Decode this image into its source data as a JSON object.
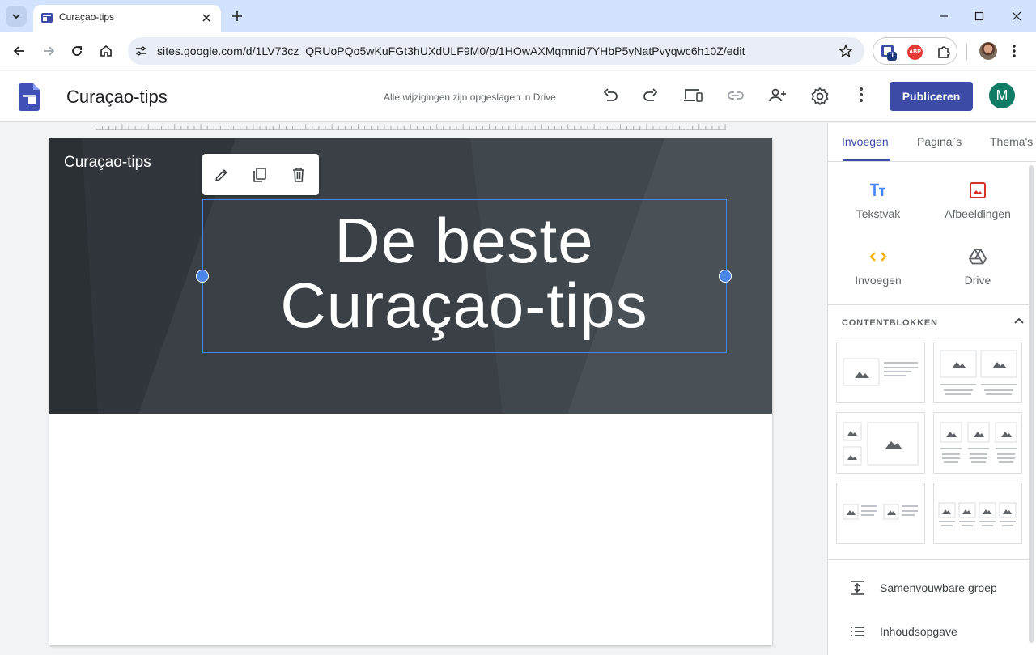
{
  "browser": {
    "tab_title": "Curaçao-tips",
    "url": "sites.google.com/d/1LV73cz_QRUoPQo5wKuFGt3hUXdULF9M0/p/1HOwAXMqmnid7YHbP5yNatPvyqwc6h10Z/edit",
    "extension_badge": "1",
    "abp_label": "ABP"
  },
  "header": {
    "site_title": "Curaçao-tips",
    "save_status": "Alle wijzigingen zijn opgeslagen in Drive",
    "publish_label": "Publiceren",
    "avatar_letter": "M"
  },
  "page": {
    "hero_site_name": "Curaçao-tips",
    "hero_title_line1": "De beste",
    "hero_title_line2": "Curaçao-tips"
  },
  "panel": {
    "tabs": [
      "Invoegen",
      "Pagina`s",
      "Thema's"
    ],
    "insert_items": [
      {
        "label": "Tekstvak",
        "icon": "text-box-icon"
      },
      {
        "label": "Afbeeldingen",
        "icon": "image-icon"
      },
      {
        "label": "Invoegen",
        "icon": "embed-code-icon"
      },
      {
        "label": "Drive",
        "icon": "drive-icon"
      }
    ],
    "section_title": "CONTENTBLOKKEN",
    "list_items": [
      {
        "label": "Samenvouwbare groep",
        "icon": "collapsible-group-icon"
      },
      {
        "label": "Inhoudsopgave",
        "icon": "table-of-contents-icon"
      }
    ]
  },
  "colors": {
    "accent": "#3c4ba6",
    "selection": "#4285f4",
    "hero_bg": "#343a3f",
    "avatar": "#117b66"
  }
}
